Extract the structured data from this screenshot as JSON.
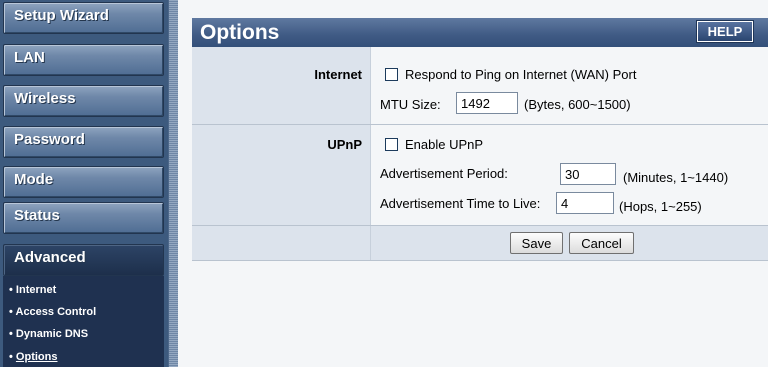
{
  "sidebar": {
    "items": [
      {
        "label": "Setup Wizard"
      },
      {
        "label": "LAN"
      },
      {
        "label": "Wireless"
      },
      {
        "label": "Password"
      },
      {
        "label": "Mode"
      },
      {
        "label": "Status"
      },
      {
        "label": "Advanced"
      }
    ],
    "submenu": [
      {
        "label": "Internet"
      },
      {
        "label": "Access Control"
      },
      {
        "label": "Dynamic DNS"
      },
      {
        "label": "Options"
      }
    ]
  },
  "header": {
    "title": "Options",
    "help_label": "HELP"
  },
  "internet": {
    "label": "Internet",
    "ping_label": "Respond to Ping on Internet (WAN) Port",
    "ping_checked": false,
    "mtu_label": "MTU Size:",
    "mtu_value": "1492",
    "mtu_hint": "(Bytes, 600~1500)"
  },
  "upnp": {
    "label": "UPnP",
    "enable_label": "Enable UPnP",
    "enable_checked": false,
    "period_label": "Advertisement Period:",
    "period_value": "30",
    "period_hint": "(Minutes, 1~1440)",
    "ttl_label": "Advertisement Time to Live:",
    "ttl_value": "4",
    "ttl_hint": "(Hops, 1~255)"
  },
  "actions": {
    "save_label": "Save",
    "cancel_label": "Cancel"
  }
}
